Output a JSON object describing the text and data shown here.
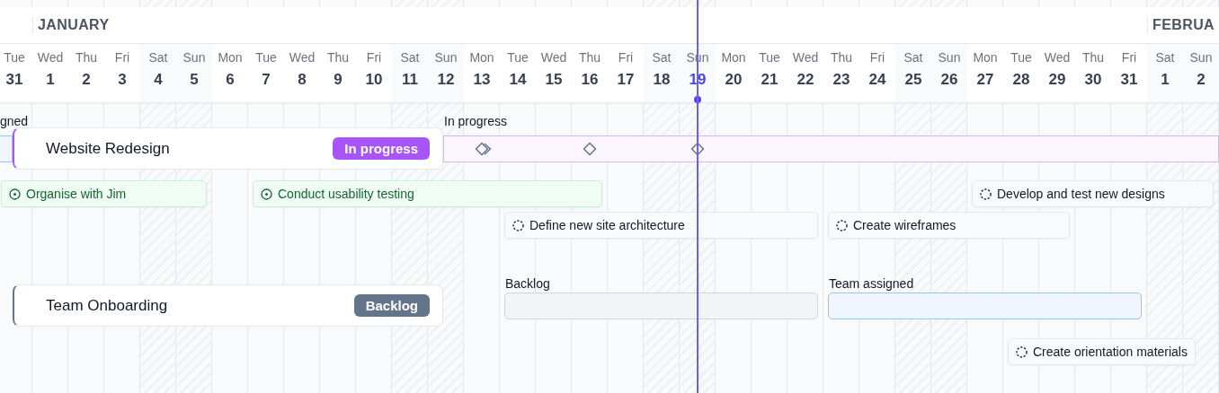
{
  "months": [
    {
      "label": "JANUARY"
    },
    {
      "label": "FEBRUA"
    }
  ],
  "days": [
    {
      "weekday": "Tue",
      "date": "31",
      "weekend": false,
      "today": false
    },
    {
      "weekday": "Wed",
      "date": "1",
      "weekend": false,
      "today": false
    },
    {
      "weekday": "Thu",
      "date": "2",
      "weekend": false,
      "today": false
    },
    {
      "weekday": "Fri",
      "date": "3",
      "weekend": false,
      "today": false
    },
    {
      "weekday": "Sat",
      "date": "4",
      "weekend": true,
      "today": false
    },
    {
      "weekday": "Sun",
      "date": "5",
      "weekend": true,
      "today": false
    },
    {
      "weekday": "Mon",
      "date": "6",
      "weekend": false,
      "today": false
    },
    {
      "weekday": "Tue",
      "date": "7",
      "weekend": false,
      "today": false
    },
    {
      "weekday": "Wed",
      "date": "8",
      "weekend": false,
      "today": false
    },
    {
      "weekday": "Thu",
      "date": "9",
      "weekend": false,
      "today": false
    },
    {
      "weekday": "Fri",
      "date": "10",
      "weekend": false,
      "today": false
    },
    {
      "weekday": "Sat",
      "date": "11",
      "weekend": true,
      "today": false
    },
    {
      "weekday": "Sun",
      "date": "12",
      "weekend": true,
      "today": false
    },
    {
      "weekday": "Mon",
      "date": "13",
      "weekend": false,
      "today": false
    },
    {
      "weekday": "Tue",
      "date": "14",
      "weekend": false,
      "today": false
    },
    {
      "weekday": "Wed",
      "date": "15",
      "weekend": false,
      "today": false
    },
    {
      "weekday": "Thu",
      "date": "16",
      "weekend": false,
      "today": false
    },
    {
      "weekday": "Fri",
      "date": "17",
      "weekend": false,
      "today": false
    },
    {
      "weekday": "Sat",
      "date": "18",
      "weekend": true,
      "today": false
    },
    {
      "weekday": "Sun",
      "date": "19",
      "weekend": true,
      "today": true
    },
    {
      "weekday": "Mon",
      "date": "20",
      "weekend": false,
      "today": false
    },
    {
      "weekday": "Tue",
      "date": "21",
      "weekend": false,
      "today": false
    },
    {
      "weekday": "Wed",
      "date": "22",
      "weekend": false,
      "today": false
    },
    {
      "weekday": "Thu",
      "date": "23",
      "weekend": false,
      "today": false
    },
    {
      "weekday": "Fri",
      "date": "24",
      "weekend": false,
      "today": false
    },
    {
      "weekday": "Sat",
      "date": "25",
      "weekend": true,
      "today": false
    },
    {
      "weekday": "Sun",
      "date": "26",
      "weekend": true,
      "today": false
    },
    {
      "weekday": "Mon",
      "date": "27",
      "weekend": false,
      "today": false
    },
    {
      "weekday": "Tue",
      "date": "28",
      "weekend": false,
      "today": false
    },
    {
      "weekday": "Wed",
      "date": "29",
      "weekend": false,
      "today": false
    },
    {
      "weekday": "Thu",
      "date": "30",
      "weekend": false,
      "today": false
    },
    {
      "weekday": "Fri",
      "date": "31",
      "weekend": false,
      "today": false
    },
    {
      "weekday": "Sat",
      "date": "1",
      "weekend": true,
      "today": false
    },
    {
      "weekday": "Sun",
      "date": "2",
      "weekend": true,
      "today": false
    }
  ],
  "projects": [
    {
      "name": "Website Redesign",
      "status": "In progress",
      "kind": "in_progress",
      "phases": [
        {
          "label": "gned",
          "kind": "team_assigned"
        },
        {
          "label": "In progress",
          "kind": "in_progress"
        }
      ],
      "milestones": [
        {
          "kind": "double"
        },
        {
          "kind": "single"
        },
        {
          "kind": "single"
        }
      ],
      "tasks": [
        {
          "title": "Organise with Jim",
          "done": true
        },
        {
          "title": "Conduct usability testing",
          "done": true
        },
        {
          "title": "Develop and test new designs",
          "done": false
        },
        {
          "title": "Define new site architecture",
          "done": false
        },
        {
          "title": "Create wireframes",
          "done": false
        }
      ]
    },
    {
      "name": "Team Onboarding",
      "status": "Backlog",
      "kind": "backlog",
      "phases": [
        {
          "label": "Backlog",
          "kind": "backlog"
        },
        {
          "label": "Team assigned",
          "kind": "team_assigned"
        }
      ],
      "tasks": [
        {
          "title": "Create orientation materials",
          "done": false
        }
      ]
    }
  ]
}
